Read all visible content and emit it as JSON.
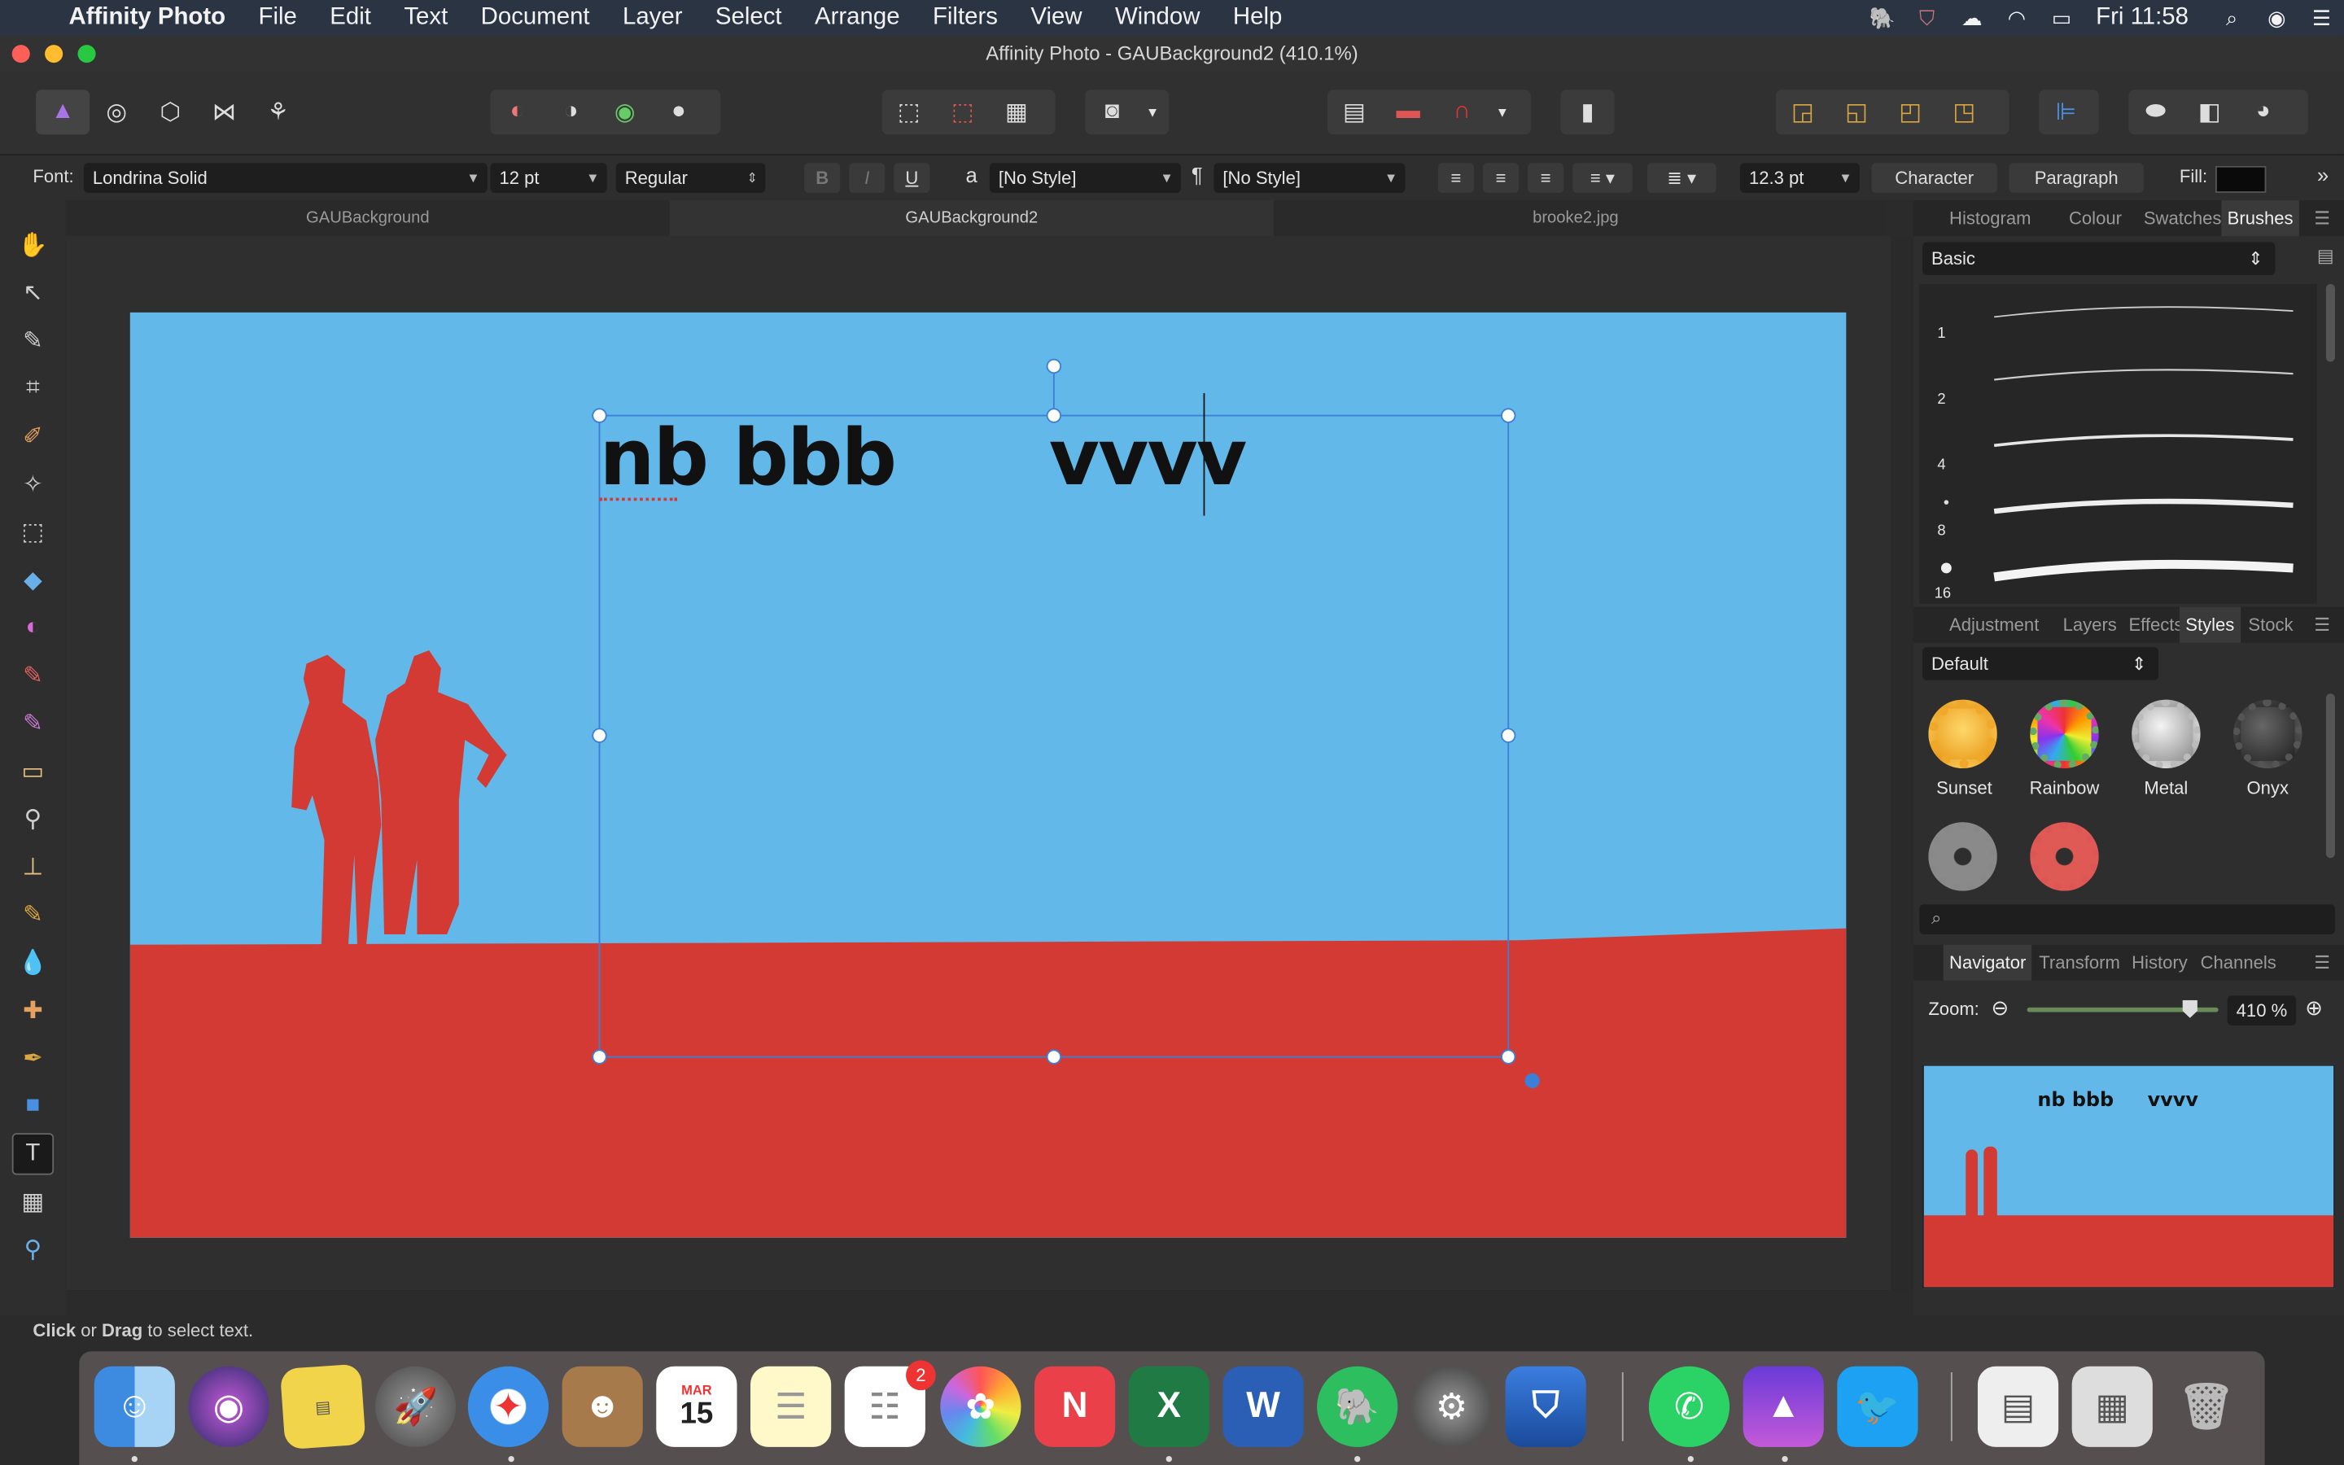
{
  "menubar": {
    "app": "Affinity Photo",
    "items": [
      "File",
      "Edit",
      "Text",
      "Document",
      "Layer",
      "Select",
      "Arrange",
      "Filters",
      "View",
      "Window",
      "Help"
    ],
    "clock": "Fri 11:58"
  },
  "window": {
    "title": "Affinity Photo - GAUBackground2 (410.1%)"
  },
  "context": {
    "font_label": "Font:",
    "font_value": "Londrina Solid",
    "size_value": "12 pt",
    "weight_value": "Regular",
    "char_style": "[No Style]",
    "para_style": "[No Style]",
    "leading_value": "12.3 pt",
    "character_button": "Character",
    "paragraph_button": "Paragraph",
    "fill_label": "Fill:",
    "bold": "B",
    "italic": "I",
    "underline": "U"
  },
  "doctabs": [
    "GAUBackground",
    "GAUBackground2",
    "brooke2.jpg"
  ],
  "canvas": {
    "text": "nb bbb      vvvv",
    "thumb_text": "nb bbb     vvvv"
  },
  "status": {
    "bold1": "Click",
    "mid": " or ",
    "bold2": "Drag",
    "rest": " to select text."
  },
  "panels": {
    "top_tabs": [
      "Histogram",
      "Colour",
      "Swatches",
      "Brushes"
    ],
    "brush_category": "Basic",
    "brush_sizes": [
      "1",
      "2",
      "4",
      "8",
      "16"
    ],
    "mid_tabs": [
      "Adjustment",
      "Layers",
      "Effects",
      "Styles",
      "Stock"
    ],
    "style_category": "Default",
    "styles": [
      "Sunset",
      "Rainbow",
      "Metal",
      "Onyx"
    ],
    "bottom_tabs": [
      "Navigator",
      "Transform",
      "History",
      "Channels"
    ],
    "zoom_label": "Zoom:",
    "zoom_value": "410 %"
  },
  "dock": {
    "calendar_month": "MAR",
    "calendar_day": "15",
    "reminders_badge": "2"
  },
  "colors": {
    "sky": "#62b8e8",
    "ground": "#d23a33",
    "accent": "#3d7fd6"
  }
}
